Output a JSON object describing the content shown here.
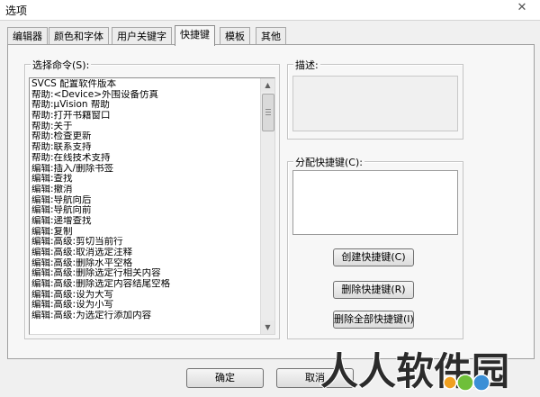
{
  "window": {
    "title": "选项",
    "close_glyph": "✕"
  },
  "tabs": [
    {
      "label": "编辑器",
      "active": false
    },
    {
      "label": "颜色和字体",
      "active": false
    },
    {
      "label": "用户关键字",
      "active": false
    },
    {
      "label": "快捷键",
      "active": true
    },
    {
      "label": "模板",
      "active": false
    },
    {
      "label": "其他",
      "active": false
    }
  ],
  "commands": {
    "label": "选择命令(S):",
    "items": [
      "SVCS 配置软件版本",
      "帮助:<Device>外围设备仿真",
      "帮助:µVision 帮助",
      "帮助:打开书籍窗口",
      "帮助:关于",
      "帮助:检查更新",
      "帮助:联系支持",
      "帮助:在线技术支持",
      "编辑:插入/删除书签",
      "编辑:查找",
      "编辑:撤消",
      "编辑:导航向后",
      "编辑:导航向前",
      "编辑:递增查找",
      "编辑:复制",
      "编辑:高级:剪切当前行",
      "编辑:高级:取消选定注释",
      "编辑:高级:删除水平空格",
      "编辑:高级:删除选定行相关内容",
      "编辑:高级:删除选定内容结尾空格",
      "编辑:高级:设为大写",
      "编辑:高级:设为小写",
      "编辑:高级:为选定行添加内容"
    ]
  },
  "description": {
    "label": "描述:",
    "text": ""
  },
  "assign": {
    "label": "分配快捷键(C):",
    "value": ""
  },
  "buttons": {
    "create": "创建快捷键(C)",
    "delete": "删除快捷键(R)",
    "delete_all": "删除全部快捷键(I)",
    "ok": "确定",
    "cancel": "取消"
  },
  "watermark": {
    "text": "人人软件园"
  },
  "colors": {
    "window_bg": "#f0f0f0",
    "panel_bg": "#f7f7f7",
    "list_bg": "#ffffff",
    "watermark": "#2b2b2b"
  }
}
